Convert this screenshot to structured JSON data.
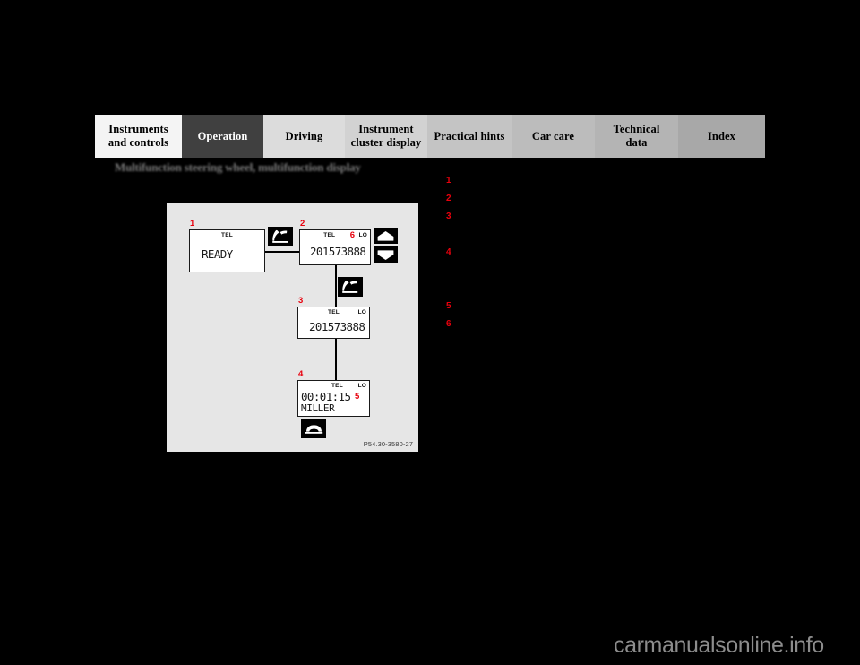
{
  "page": {
    "background_color": "#000000",
    "watermark": "carmanualsonline.info"
  },
  "tabbar": {
    "active_index": 1,
    "tabs": [
      {
        "label_line1": "Instruments",
        "label_line2": "and controls",
        "bg": "#f4f4f4",
        "fg": "#000000",
        "width": 97
      },
      {
        "label_line1": "Operation",
        "label_line2": "",
        "bg": "#404040",
        "fg": "#ffffff",
        "width": 91
      },
      {
        "label_line1": "Driving",
        "label_line2": "",
        "bg": "#dcdcdc",
        "fg": "#000000",
        "width": 91
      },
      {
        "label_line1": "Instrument",
        "label_line2": "cluster display",
        "bg": "#d2d2d2",
        "fg": "#000000",
        "width": 92
      },
      {
        "label_line1": "Practical hints",
        "label_line2": "",
        "bg": "#c4c4c4",
        "fg": "#000000",
        "width": 94
      },
      {
        "label_line1": "Car care",
        "label_line2": "",
        "bg": "#bcbcbc",
        "fg": "#000000",
        "width": 93
      },
      {
        "label_line1": "Technical",
        "label_line2": "data",
        "bg": "#b4b4b4",
        "fg": "#000000",
        "width": 93
      },
      {
        "label_line1": "Index",
        "label_line2": "",
        "bg": "#a8a8a8",
        "fg": "#000000",
        "width": 97
      }
    ]
  },
  "section": {
    "title": "Multifunction steering wheel, multifunction display"
  },
  "figure": {
    "reference": "P54.30-3580-27",
    "background": "#e6e6e6",
    "displays": [
      {
        "marker": "1",
        "header_left": "",
        "header_center": "TEL",
        "header_right": "",
        "main_text": "READY",
        "sub_text": ""
      },
      {
        "marker": "2",
        "header_left": "",
        "header_center": "TEL",
        "header_right": "LO",
        "inline_marker": "6",
        "main_text": "201573888",
        "sub_text": ""
      },
      {
        "marker": "3",
        "header_left": "",
        "header_center": "TEL",
        "header_right": "LO",
        "main_text": "201573888",
        "sub_text": ""
      },
      {
        "marker": "4",
        "header_left": "",
        "header_center": "TEL",
        "header_right": "LO",
        "inline_marker": "5",
        "main_text": "00:01:15",
        "sub_text": "MILLER"
      }
    ],
    "buttons": [
      {
        "name": "phone-offhook-icon-1",
        "icon": "phone-offhook"
      },
      {
        "name": "phone-offhook-icon-2",
        "icon": "phone-offhook"
      },
      {
        "name": "arrow-up-icon",
        "icon": "arrow-up"
      },
      {
        "name": "arrow-down-icon",
        "icon": "arrow-down"
      },
      {
        "name": "phone-onhook-icon",
        "icon": "phone-onhook"
      }
    ],
    "marker_color": "#e8000d"
  },
  "legend": {
    "items": [
      {
        "num": "1",
        "text": ""
      },
      {
        "num": "2",
        "text": ""
      },
      {
        "num": "3",
        "text": ""
      },
      {
        "num": "4",
        "text": ""
      },
      {
        "num": "5",
        "text": ""
      },
      {
        "num": "6",
        "text": ""
      }
    ]
  }
}
